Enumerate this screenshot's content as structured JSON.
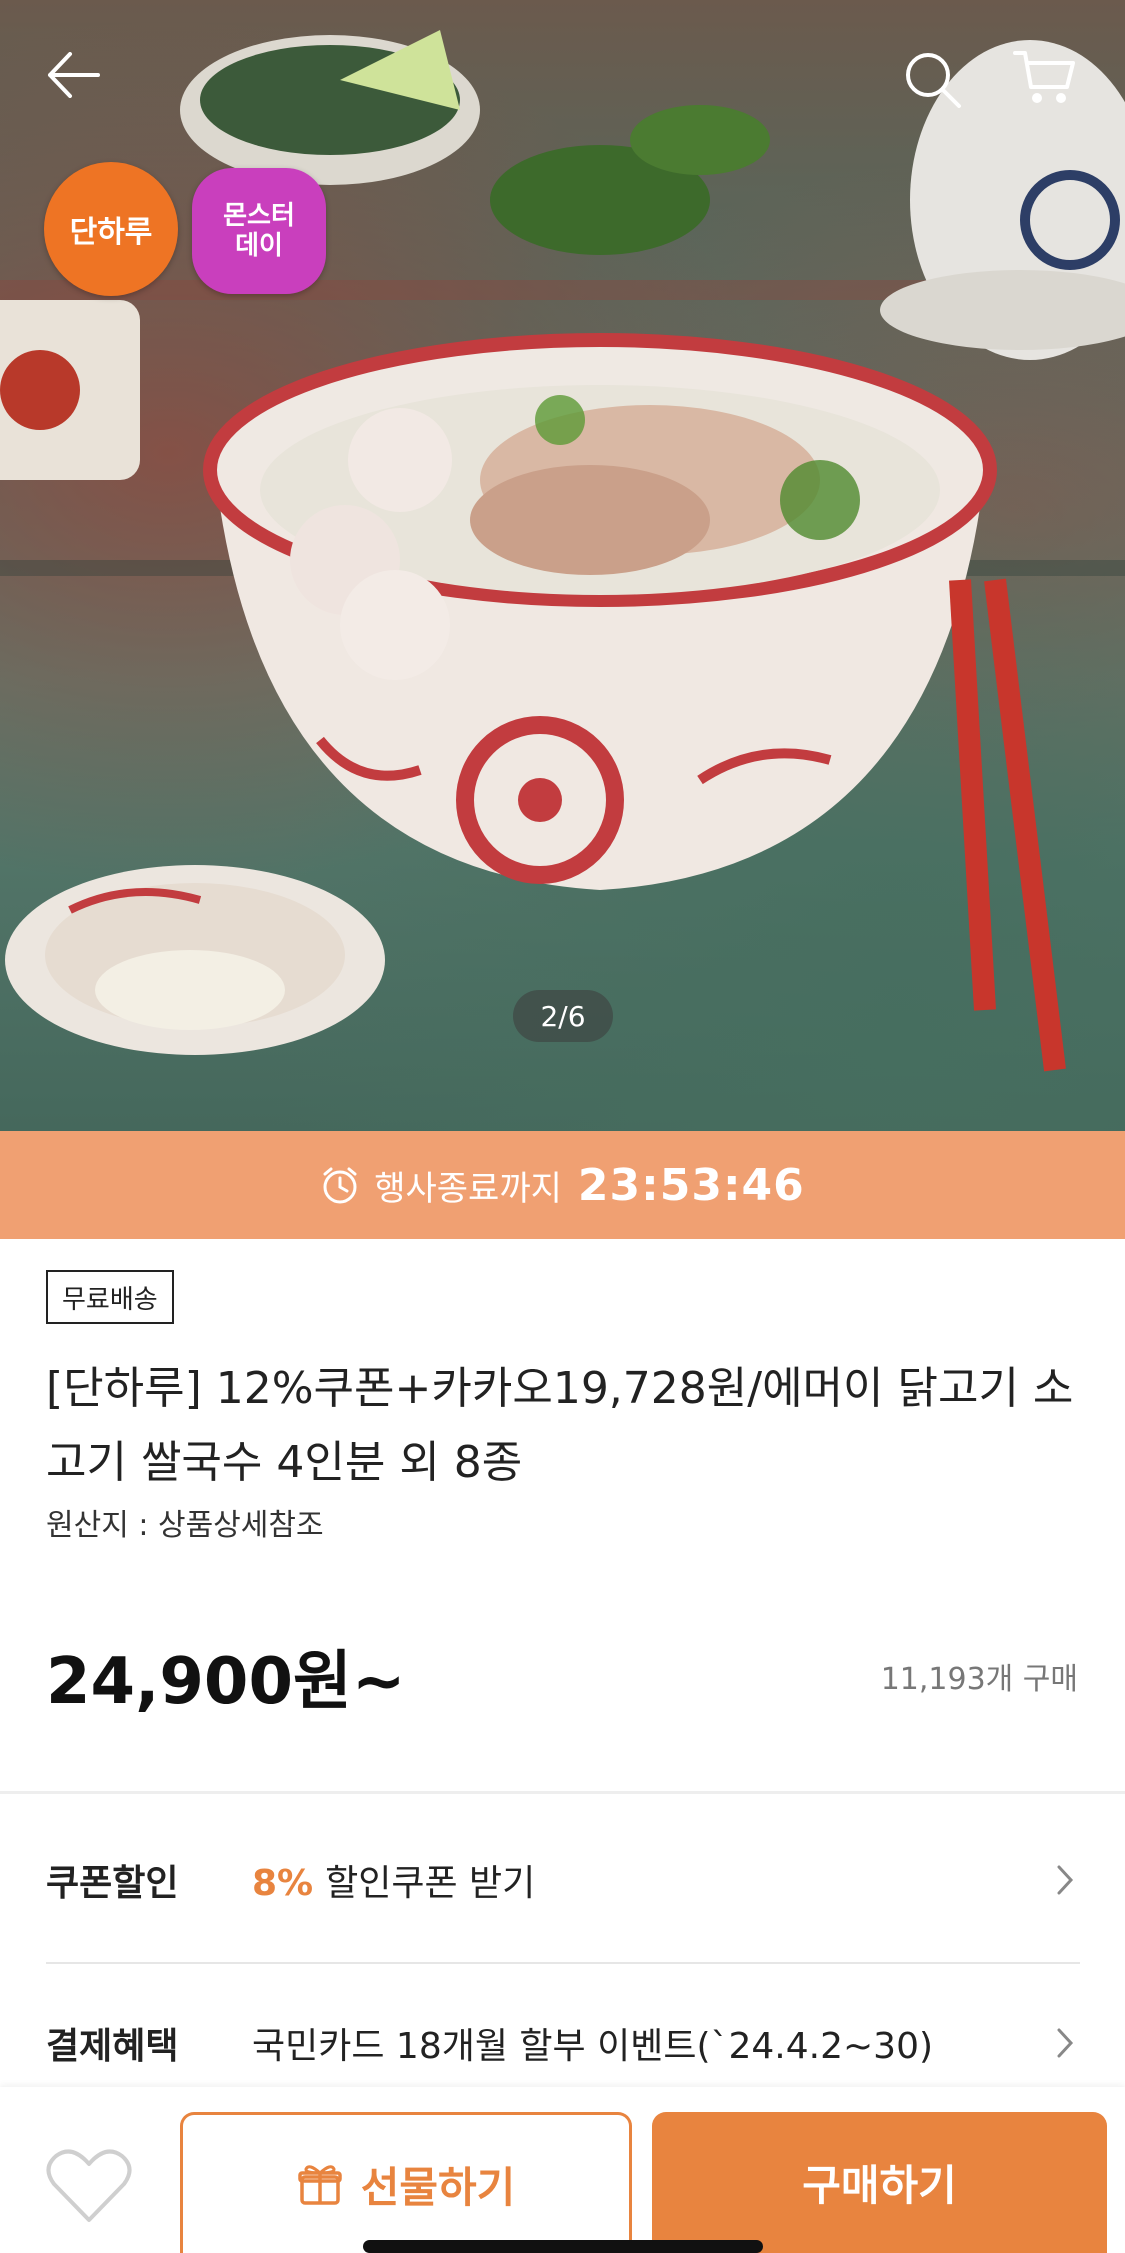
{
  "hero": {
    "badge_danharu": "단하루",
    "badge_monster_line1": "몬스터",
    "badge_monster_line2": "데이",
    "pager": "2/6"
  },
  "countdown": {
    "label": "행사종료까지",
    "time": "23:53:46"
  },
  "product": {
    "free_shipping": "무료배송",
    "title": "[단하루] 12%쿠폰+카카오19,728원/에머이 닭고기 소고기 쌀국수 4인분 외 8종",
    "origin": "원산지 : 상품상세참조",
    "price": "24,900원~",
    "purchases": "11,193개 구매"
  },
  "benefits": {
    "coupon_key": "쿠폰할인",
    "coupon_pct": "8%",
    "coupon_value": "할인쿠폰 받기",
    "pay_key": "결제혜택",
    "pay_value": "국민카드 18개월 할부 이벤트(`24.4.2~30)"
  },
  "actions": {
    "gift_label": "선물하기",
    "buy_label": "구매하기"
  },
  "colors": {
    "accent": "#e8843f",
    "countdown_bg": "#f0a072",
    "badge_orange": "#ee7424",
    "badge_purple": "#c93fbd"
  },
  "icons": [
    "back-arrow-icon",
    "search-icon",
    "cart-icon",
    "clock-icon",
    "chevron-right-icon",
    "heart-icon",
    "gift-icon"
  ]
}
